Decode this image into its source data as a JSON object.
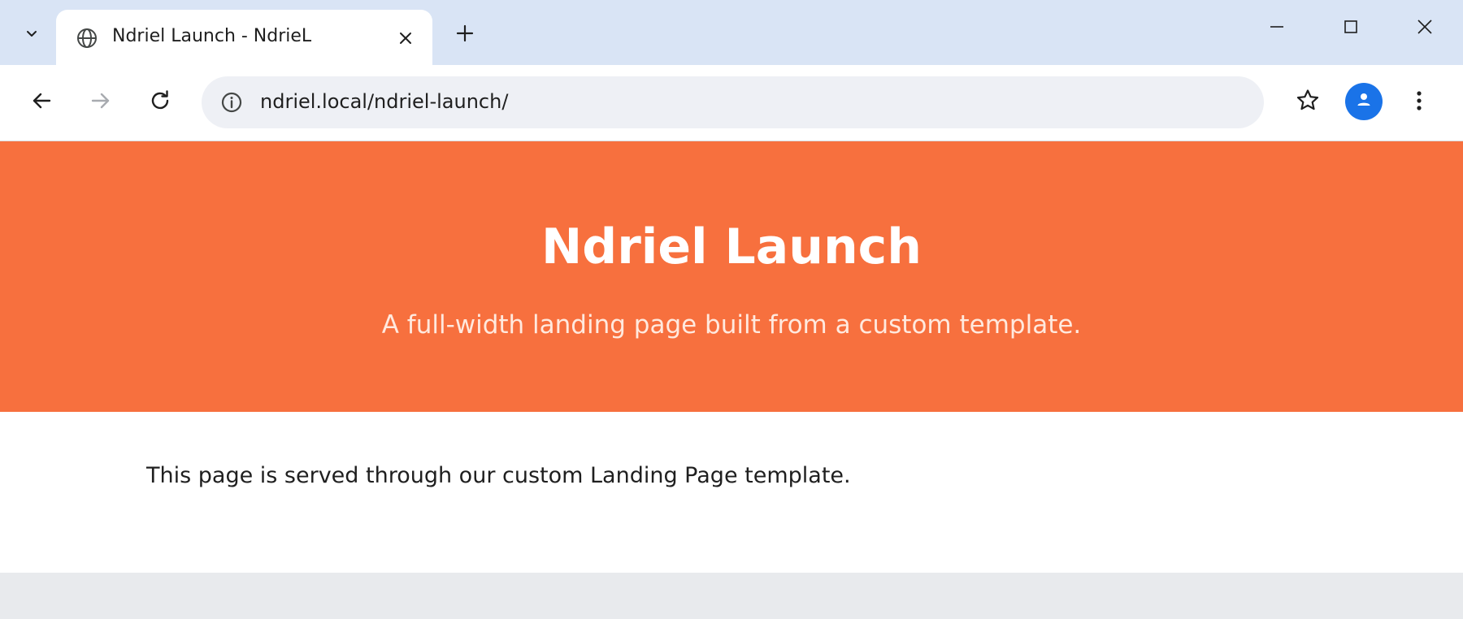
{
  "browser": {
    "tab": {
      "title": "Ndriel Launch - NdrieL",
      "favicon_icon": "globe-icon",
      "close_icon": "close-icon"
    },
    "tab_search_icon": "chevron-down-icon",
    "new_tab_icon": "plus-icon",
    "window_controls": {
      "minimize_icon": "minimize-icon",
      "maximize_icon": "maximize-icon",
      "close_icon": "close-icon"
    },
    "toolbar": {
      "back_icon": "arrow-left-icon",
      "forward_icon": "arrow-right-icon",
      "reload_icon": "reload-icon",
      "site_info_icon": "info-icon",
      "url": "ndriel.local/ndriel-launch/",
      "bookmark_icon": "star-icon",
      "profile_icon": "person-icon",
      "menu_icon": "more-vertical-icon"
    }
  },
  "page": {
    "hero": {
      "title": "Ndriel Launch",
      "subtitle": "A full-width landing page built from a custom template."
    },
    "body_text": "This page is served through our custom Landing Page template."
  },
  "colors": {
    "hero_background": "#f7703e",
    "tabstrip_background": "#d9e4f5",
    "avatar_background": "#1a73e8"
  }
}
